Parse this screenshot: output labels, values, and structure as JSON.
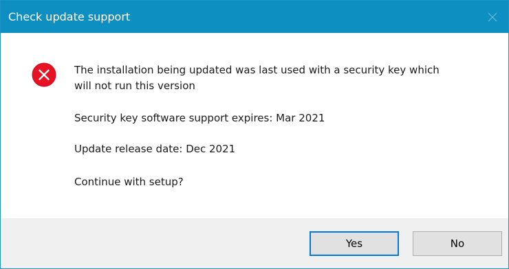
{
  "dialog": {
    "title": "Check update support",
    "close_icon": "close-icon",
    "icon": "error-icon",
    "colors": {
      "title_bar": "#0d8fc2",
      "error_red": "#e81123",
      "default_button_border": "#0078d7",
      "footer_background": "#f0f0f0"
    },
    "message": {
      "line1": "The installation being updated was last used with a security key which",
      "line1_cont": "will not run this version",
      "support_expires": "Security key software support expires: Mar 2021",
      "release_date": "Update release date: Dec 2021",
      "question": "Continue with setup?"
    },
    "buttons": {
      "yes_label": "Yes",
      "no_label": "No"
    }
  }
}
